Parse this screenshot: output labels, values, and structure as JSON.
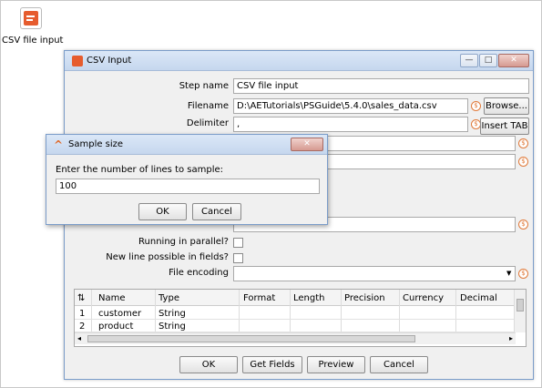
{
  "desktop": {
    "step_caption": "CSV file input"
  },
  "window": {
    "title": "CSV Input",
    "controls": {
      "minimize": "—",
      "maximize": "□",
      "close": "✕"
    },
    "form": {
      "step_name_label": "Step name",
      "step_name_value": "CSV file input",
      "filename_label": "Filename",
      "filename_value": "D:\\AETutorials\\PSGuide\\5.4.0\\sales_data.csv",
      "browse_button": "Browse...",
      "delimiter_label": "Delimiter",
      "delimiter_value": ",",
      "insert_tab_button": "Insert TAB",
      "running_parallel_label": "Running in parallel?",
      "running_parallel_checked": false,
      "new_line_label": "New line possible in fields?",
      "new_line_checked": false,
      "file_encoding_label": "File encoding",
      "file_encoding_value": ""
    },
    "table": {
      "columns": [
        "#",
        "Name",
        "Type",
        "Format",
        "Length",
        "Precision",
        "Currency",
        "Decimal"
      ],
      "rows": [
        [
          "1",
          "customer",
          "String",
          "",
          "",
          "",
          "",
          ""
        ],
        [
          "2",
          "product",
          "String",
          "",
          "",
          "",
          "",
          ""
        ]
      ]
    },
    "buttons": {
      "ok": "OK",
      "get_fields": "Get Fields",
      "preview": "Preview",
      "cancel": "Cancel"
    }
  },
  "sample_dialog": {
    "title": "Sample size",
    "close": "✕",
    "prompt": "Enter the number of lines to sample:",
    "value": "100",
    "ok": "OK",
    "cancel": "Cancel"
  },
  "colors": {
    "accent": "#e65c2e",
    "variable_icon": "#e07a3a",
    "title_bar": "#c6d7ee"
  },
  "icons": {
    "step": "csv-step-icon",
    "variable": "dollar-variable-icon",
    "sort": "sort-icon"
  }
}
